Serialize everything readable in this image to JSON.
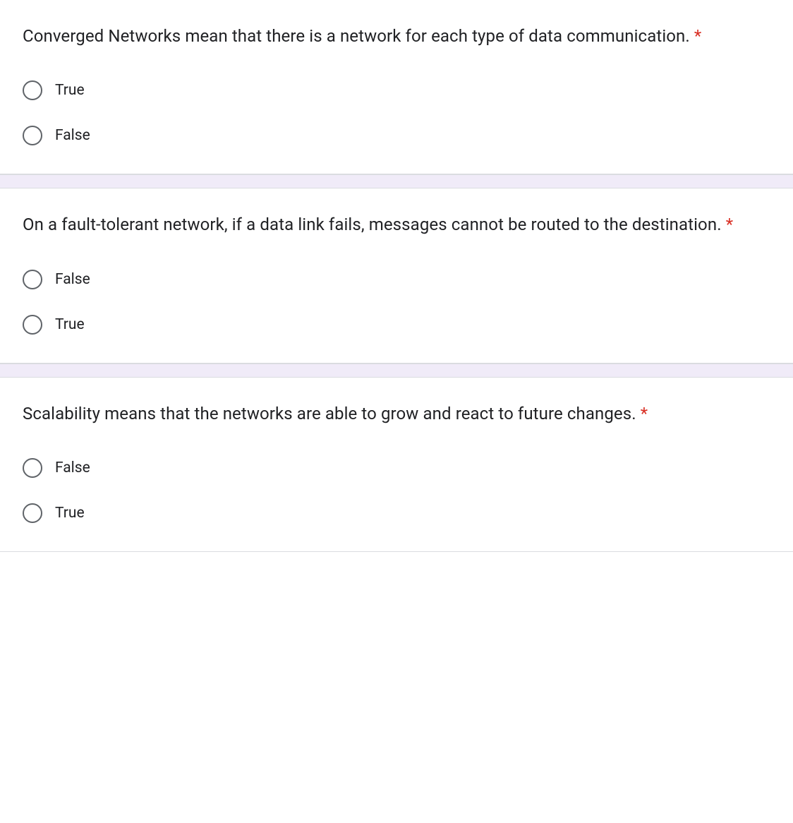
{
  "required_marker": "*",
  "questions": [
    {
      "text": "Converged Networks mean that there is a network for each type of data communication.",
      "options": [
        "True",
        "False"
      ]
    },
    {
      "text": "On a fault-tolerant network, if a data link fails, messages cannot be routed to the destination.",
      "options": [
        "False",
        "True"
      ]
    },
    {
      "text": "Scalability means that the networks are able to grow and react to future changes.",
      "options": [
        "False",
        "True"
      ]
    }
  ]
}
